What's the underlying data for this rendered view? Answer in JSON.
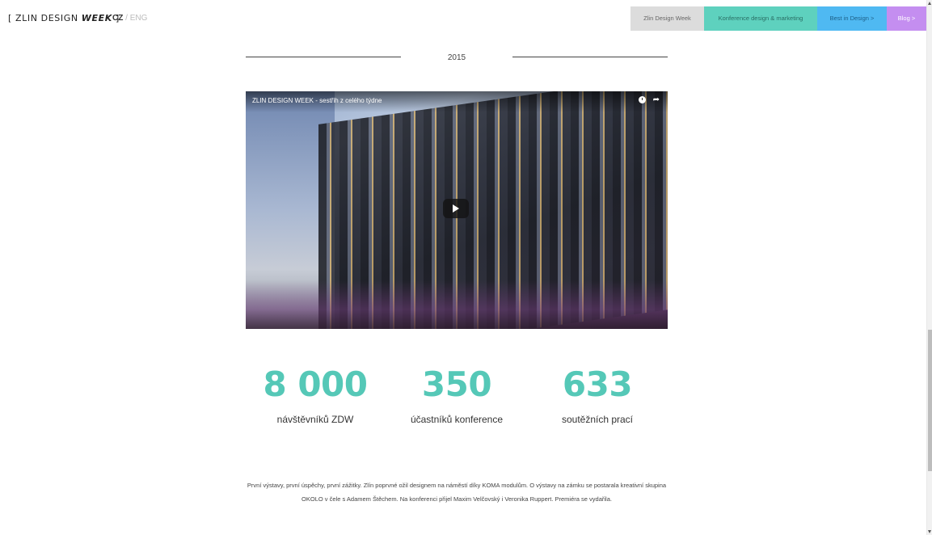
{
  "header": {
    "logo": {
      "bracket_open": "[",
      "text_plain": "ZLIN DESIGN",
      "text_accent": "WEEK",
      "bracket_close": "]"
    },
    "lang": {
      "cz": "CZ",
      "sep": " / ",
      "eng": "ENG"
    },
    "nav": [
      {
        "label": "Zlin Design Week",
        "color": "#dcdcdc"
      },
      {
        "label": "Konference design & marketing",
        "color": "#5ed1be"
      },
      {
        "label": "Best in Design >",
        "color": "#4fb9f2"
      },
      {
        "label": "Blog >",
        "color": "#c48ef0"
      }
    ]
  },
  "section": {
    "year": "2015"
  },
  "video": {
    "title": "ZLIN DESIGN WEEK - sestřih z celého týdne",
    "icons": [
      "clock-icon",
      "share-icon",
      "play-icon"
    ]
  },
  "stats": [
    {
      "value": "8 000",
      "label": "návštěvníků ZDW"
    },
    {
      "value": "350",
      "label": "účastníků konference"
    },
    {
      "value": "633",
      "label": "soutěžních prací"
    }
  ],
  "description": "První výstavy, první úspěchy, první zážitky. Zlín poprvné ožil designem na náměstí díky KOMA modulům. O výstavy na zámku se postarala kreativní skupina OKOLO v čele s Adamem Štěchem. Na konferenci přijel Maxim Velčovský i Veronika Ruppert. Premiéra se vydařila.",
  "colors": {
    "accent": "#55c8b7",
    "nav_gray": "#dcdcdc",
    "nav_teal": "#5ed1be",
    "nav_blue": "#4fb9f2",
    "nav_purple": "#c48ef0"
  }
}
